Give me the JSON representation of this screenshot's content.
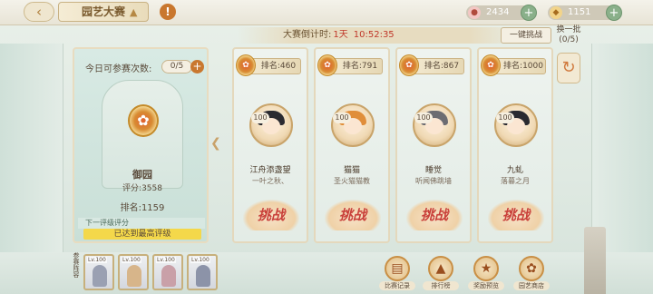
{
  "header": {
    "back_icon": "chevron-left-icon",
    "title": "园艺大赛",
    "currency_1": {
      "icon": "coin-icon",
      "value": "2434"
    },
    "currency_2": {
      "icon": "gem-icon",
      "value": "1151"
    }
  },
  "countdown": {
    "label": "大赛倒计时:",
    "days": "1天",
    "time": "10:52:35"
  },
  "actions": {
    "challenge_all": "一键挑战",
    "switch_label": "换一批",
    "switch_count": "(0/5)"
  },
  "player": {
    "attempts_label": "今日可参赛次数:",
    "attempts_value": "0/5",
    "tier_name": "御园",
    "score": "评分:3558",
    "rank": "排名:1159",
    "next_tier_label": "下一评级评分",
    "max_tier_text": "已达到最高评级"
  },
  "opponents": [
    {
      "rank": "排名:460",
      "level": "100",
      "name": "江舟添盏望",
      "title": "一叶之秋、"
    },
    {
      "rank": "排名:791",
      "level": "100",
      "name": "猫猫",
      "title": "圣火猫猫教"
    },
    {
      "rank": "排名:867",
      "level": "100",
      "name": "睡觉",
      "title": "听闻佛跳墙"
    },
    {
      "rank": "排名:1000",
      "level": "100",
      "name": "九虬",
      "title": "落暮之月"
    }
  ],
  "challenge_label": "挑战",
  "team": {
    "label": "参赛阵容",
    "levels": [
      "Lv.100",
      "Lv.100",
      "Lv.100",
      "Lv.100"
    ]
  },
  "bottom_nav": [
    {
      "icon": "record-icon",
      "label": "比赛记录"
    },
    {
      "icon": "ranking-icon",
      "label": "排行榜"
    },
    {
      "icon": "reward-icon",
      "label": "奖励预览"
    },
    {
      "icon": "shop-icon",
      "label": "园艺商店"
    }
  ],
  "colors": {
    "accent_red": "#c0392b",
    "gold": "#c9a26a",
    "max_tier_bg": "#f4d84a"
  }
}
